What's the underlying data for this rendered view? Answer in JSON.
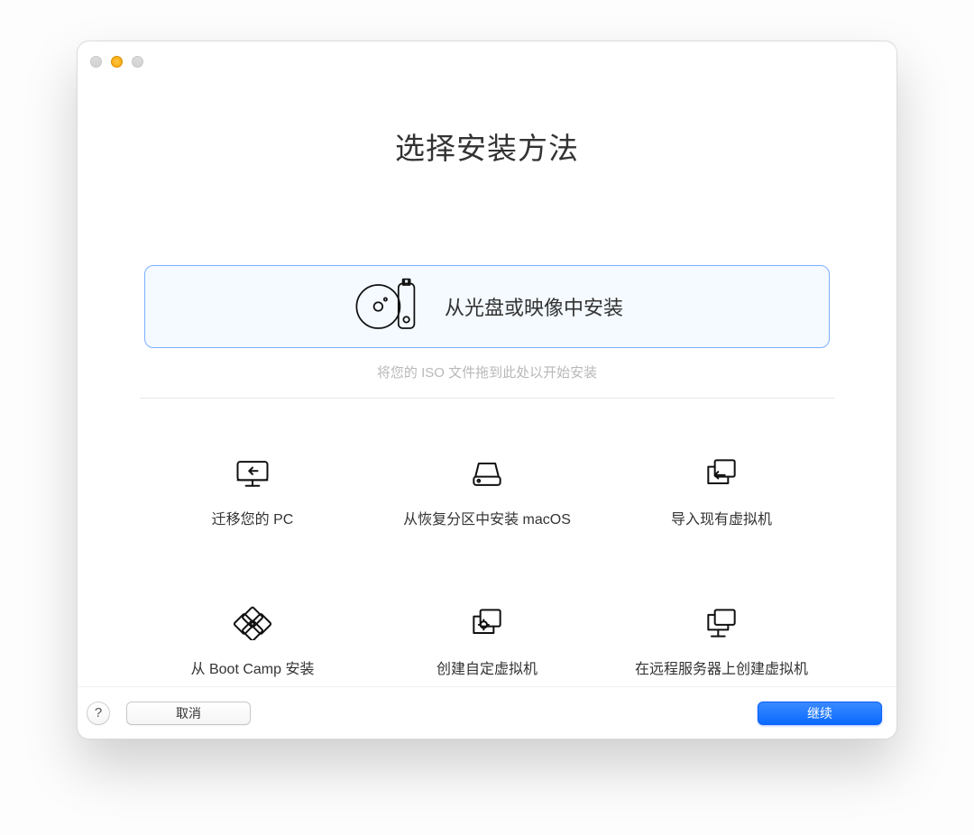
{
  "header": {
    "title": "选择安装方法"
  },
  "primary": {
    "label": "从光盘或映像中安装",
    "hint": "将您的 ISO 文件拖到此处以开始安装"
  },
  "options": [
    {
      "id": "migrate-pc",
      "label": "迁移您的 PC"
    },
    {
      "id": "recovery-install",
      "label": "从恢复分区中安装 macOS"
    },
    {
      "id": "import-vm",
      "label": "导入现有虚拟机"
    },
    {
      "id": "bootcamp-install",
      "label": "从 Boot Camp 安装"
    },
    {
      "id": "create-custom-vm",
      "label": "创建自定虚拟机"
    },
    {
      "id": "remote-server-vm",
      "label": "在远程服务器上创建虚拟机"
    }
  ],
  "footer": {
    "help": "?",
    "cancel": "取消",
    "continue": "继续"
  }
}
